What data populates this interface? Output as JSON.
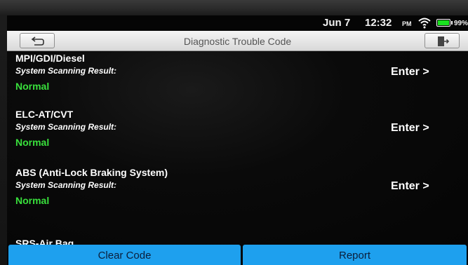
{
  "status_bar": {
    "date": "Jun 7",
    "time": "12:32",
    "ampm": "PM",
    "battery_percent": "99%",
    "battery_color": "#19e21f"
  },
  "header": {
    "title": "Diagnostic Trouble Code",
    "back_icon": "back-arrow-icon",
    "exit_icon": "exit-door-icon"
  },
  "systems": [
    {
      "name": "MPI/GDI/Diesel",
      "result_label": "System Scanning Result:",
      "status": "Normal",
      "action": "Enter >"
    },
    {
      "name": "ELC-AT/CVT",
      "result_label": "System Scanning Result:",
      "status": "Normal",
      "action": "Enter >"
    },
    {
      "name": "ABS (Anti-Lock Braking System)",
      "result_label": "System Scanning Result:",
      "status": "Normal",
      "action": "Enter >"
    },
    {
      "name": "SRS-Air Bag"
    }
  ],
  "footer": {
    "clear_label": "Clear Code",
    "report_label": "Report",
    "button_color": "#1ea0ee"
  }
}
